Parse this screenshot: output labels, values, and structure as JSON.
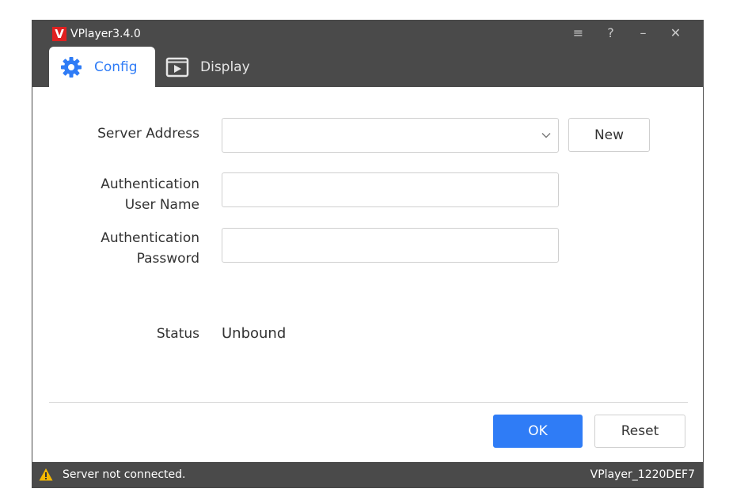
{
  "window": {
    "logo_letter": "V",
    "title": "VPlayer3.4.0",
    "controls": [
      {
        "name": "menu-icon",
        "glyph": "≡"
      },
      {
        "name": "help-icon",
        "glyph": "?"
      },
      {
        "name": "minimize-icon",
        "glyph": "–"
      },
      {
        "name": "close-icon",
        "glyph": "✕"
      }
    ]
  },
  "tabs": [
    {
      "label": "Config",
      "icon": "gear-icon",
      "active": true
    },
    {
      "label": "Display",
      "icon": "display-icon",
      "active": false
    }
  ],
  "form": {
    "server_address": {
      "label": "Server Address",
      "value": ""
    },
    "auth_user": {
      "label_line1": "Authentication",
      "label_line2": "User Name",
      "value": ""
    },
    "auth_password": {
      "label_line1": "Authentication",
      "label_line2": "Password",
      "value": ""
    },
    "new_button": "New",
    "status": {
      "label": "Status",
      "value": "Unbound"
    }
  },
  "actions": {
    "ok": "OK",
    "reset": "Reset"
  },
  "statusbar": {
    "message": "Server not connected.",
    "device": "VPlayer_1220DEF7"
  },
  "colors": {
    "accent": "#2f7cf6",
    "chrome": "#4a4a4a",
    "logo": "#e02020",
    "warning": "#f5b800"
  }
}
